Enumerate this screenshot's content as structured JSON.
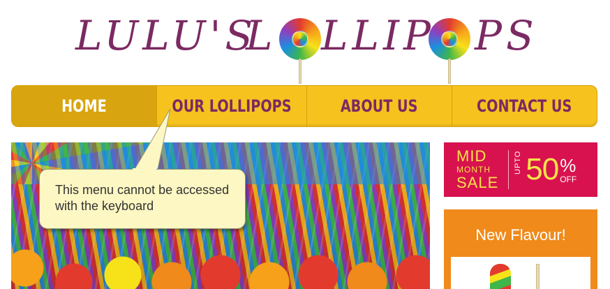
{
  "logo": {
    "word1": "LULU'S",
    "word2_start": "L",
    "word2_mid": "LLIP",
    "word2_end": "PS",
    "icon": "lollipop-icon"
  },
  "nav": {
    "items": [
      {
        "label": "HOME",
        "active": true
      },
      {
        "label": "OUR LOLLIPOPS",
        "active": false
      },
      {
        "label": "ABOUT US",
        "active": false
      },
      {
        "label": "CONTACT US",
        "active": false
      }
    ]
  },
  "callout": {
    "text": "This menu cannot be accessed with the keyboard"
  },
  "sale": {
    "line1": "MID",
    "line2": "MONTH",
    "line3": "SALE",
    "upto": "UPTO",
    "percent": "50",
    "symbol": "%",
    "off": "OFF"
  },
  "flavour": {
    "title": "New Flavour!"
  },
  "colors": {
    "brand_purple": "#7b2a63",
    "nav_yellow": "#f6c21d",
    "nav_active": "#d8a40f",
    "sale_pink": "#d8124e",
    "sale_yellow": "#f5e34a",
    "flavour_orange": "#f08a1a",
    "callout_bg": "#fdf7c3"
  }
}
